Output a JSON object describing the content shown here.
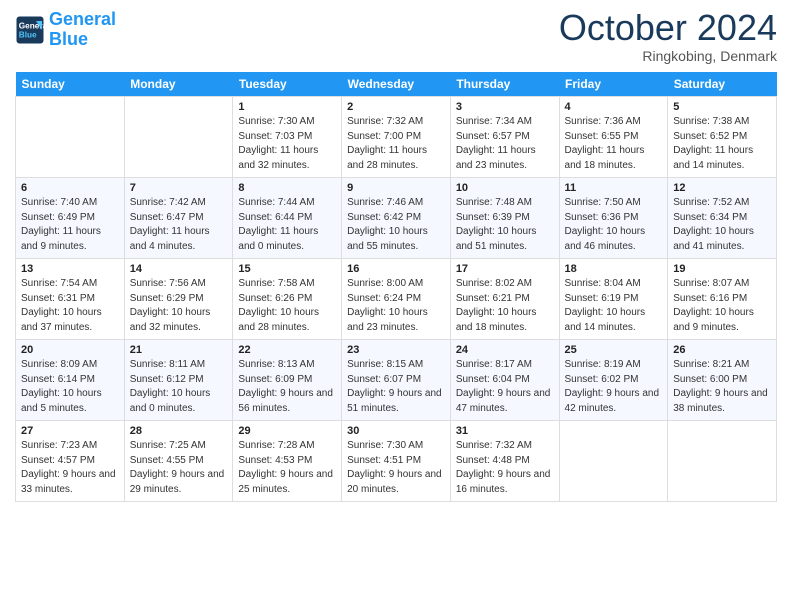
{
  "header": {
    "logo_line1": "General",
    "logo_line2": "Blue",
    "month": "October 2024",
    "location": "Ringkobing, Denmark"
  },
  "days_of_week": [
    "Sunday",
    "Monday",
    "Tuesday",
    "Wednesday",
    "Thursday",
    "Friday",
    "Saturday"
  ],
  "weeks": [
    [
      {
        "day": "",
        "sunrise": "",
        "sunset": "",
        "daylight": ""
      },
      {
        "day": "",
        "sunrise": "",
        "sunset": "",
        "daylight": ""
      },
      {
        "day": "1",
        "sunrise": "Sunrise: 7:30 AM",
        "sunset": "Sunset: 7:03 PM",
        "daylight": "Daylight: 11 hours and 32 minutes."
      },
      {
        "day": "2",
        "sunrise": "Sunrise: 7:32 AM",
        "sunset": "Sunset: 7:00 PM",
        "daylight": "Daylight: 11 hours and 28 minutes."
      },
      {
        "day": "3",
        "sunrise": "Sunrise: 7:34 AM",
        "sunset": "Sunset: 6:57 PM",
        "daylight": "Daylight: 11 hours and 23 minutes."
      },
      {
        "day": "4",
        "sunrise": "Sunrise: 7:36 AM",
        "sunset": "Sunset: 6:55 PM",
        "daylight": "Daylight: 11 hours and 18 minutes."
      },
      {
        "day": "5",
        "sunrise": "Sunrise: 7:38 AM",
        "sunset": "Sunset: 6:52 PM",
        "daylight": "Daylight: 11 hours and 14 minutes."
      }
    ],
    [
      {
        "day": "6",
        "sunrise": "Sunrise: 7:40 AM",
        "sunset": "Sunset: 6:49 PM",
        "daylight": "Daylight: 11 hours and 9 minutes."
      },
      {
        "day": "7",
        "sunrise": "Sunrise: 7:42 AM",
        "sunset": "Sunset: 6:47 PM",
        "daylight": "Daylight: 11 hours and 4 minutes."
      },
      {
        "day": "8",
        "sunrise": "Sunrise: 7:44 AM",
        "sunset": "Sunset: 6:44 PM",
        "daylight": "Daylight: 11 hours and 0 minutes."
      },
      {
        "day": "9",
        "sunrise": "Sunrise: 7:46 AM",
        "sunset": "Sunset: 6:42 PM",
        "daylight": "Daylight: 10 hours and 55 minutes."
      },
      {
        "day": "10",
        "sunrise": "Sunrise: 7:48 AM",
        "sunset": "Sunset: 6:39 PM",
        "daylight": "Daylight: 10 hours and 51 minutes."
      },
      {
        "day": "11",
        "sunrise": "Sunrise: 7:50 AM",
        "sunset": "Sunset: 6:36 PM",
        "daylight": "Daylight: 10 hours and 46 minutes."
      },
      {
        "day": "12",
        "sunrise": "Sunrise: 7:52 AM",
        "sunset": "Sunset: 6:34 PM",
        "daylight": "Daylight: 10 hours and 41 minutes."
      }
    ],
    [
      {
        "day": "13",
        "sunrise": "Sunrise: 7:54 AM",
        "sunset": "Sunset: 6:31 PM",
        "daylight": "Daylight: 10 hours and 37 minutes."
      },
      {
        "day": "14",
        "sunrise": "Sunrise: 7:56 AM",
        "sunset": "Sunset: 6:29 PM",
        "daylight": "Daylight: 10 hours and 32 minutes."
      },
      {
        "day": "15",
        "sunrise": "Sunrise: 7:58 AM",
        "sunset": "Sunset: 6:26 PM",
        "daylight": "Daylight: 10 hours and 28 minutes."
      },
      {
        "day": "16",
        "sunrise": "Sunrise: 8:00 AM",
        "sunset": "Sunset: 6:24 PM",
        "daylight": "Daylight: 10 hours and 23 minutes."
      },
      {
        "day": "17",
        "sunrise": "Sunrise: 8:02 AM",
        "sunset": "Sunset: 6:21 PM",
        "daylight": "Daylight: 10 hours and 18 minutes."
      },
      {
        "day": "18",
        "sunrise": "Sunrise: 8:04 AM",
        "sunset": "Sunset: 6:19 PM",
        "daylight": "Daylight: 10 hours and 14 minutes."
      },
      {
        "day": "19",
        "sunrise": "Sunrise: 8:07 AM",
        "sunset": "Sunset: 6:16 PM",
        "daylight": "Daylight: 10 hours and 9 minutes."
      }
    ],
    [
      {
        "day": "20",
        "sunrise": "Sunrise: 8:09 AM",
        "sunset": "Sunset: 6:14 PM",
        "daylight": "Daylight: 10 hours and 5 minutes."
      },
      {
        "day": "21",
        "sunrise": "Sunrise: 8:11 AM",
        "sunset": "Sunset: 6:12 PM",
        "daylight": "Daylight: 10 hours and 0 minutes."
      },
      {
        "day": "22",
        "sunrise": "Sunrise: 8:13 AM",
        "sunset": "Sunset: 6:09 PM",
        "daylight": "Daylight: 9 hours and 56 minutes."
      },
      {
        "day": "23",
        "sunrise": "Sunrise: 8:15 AM",
        "sunset": "Sunset: 6:07 PM",
        "daylight": "Daylight: 9 hours and 51 minutes."
      },
      {
        "day": "24",
        "sunrise": "Sunrise: 8:17 AM",
        "sunset": "Sunset: 6:04 PM",
        "daylight": "Daylight: 9 hours and 47 minutes."
      },
      {
        "day": "25",
        "sunrise": "Sunrise: 8:19 AM",
        "sunset": "Sunset: 6:02 PM",
        "daylight": "Daylight: 9 hours and 42 minutes."
      },
      {
        "day": "26",
        "sunrise": "Sunrise: 8:21 AM",
        "sunset": "Sunset: 6:00 PM",
        "daylight": "Daylight: 9 hours and 38 minutes."
      }
    ],
    [
      {
        "day": "27",
        "sunrise": "Sunrise: 7:23 AM",
        "sunset": "Sunset: 4:57 PM",
        "daylight": "Daylight: 9 hours and 33 minutes."
      },
      {
        "day": "28",
        "sunrise": "Sunrise: 7:25 AM",
        "sunset": "Sunset: 4:55 PM",
        "daylight": "Daylight: 9 hours and 29 minutes."
      },
      {
        "day": "29",
        "sunrise": "Sunrise: 7:28 AM",
        "sunset": "Sunset: 4:53 PM",
        "daylight": "Daylight: 9 hours and 25 minutes."
      },
      {
        "day": "30",
        "sunrise": "Sunrise: 7:30 AM",
        "sunset": "Sunset: 4:51 PM",
        "daylight": "Daylight: 9 hours and 20 minutes."
      },
      {
        "day": "31",
        "sunrise": "Sunrise: 7:32 AM",
        "sunset": "Sunset: 4:48 PM",
        "daylight": "Daylight: 9 hours and 16 minutes."
      },
      {
        "day": "",
        "sunrise": "",
        "sunset": "",
        "daylight": ""
      },
      {
        "day": "",
        "sunrise": "",
        "sunset": "",
        "daylight": ""
      }
    ]
  ]
}
